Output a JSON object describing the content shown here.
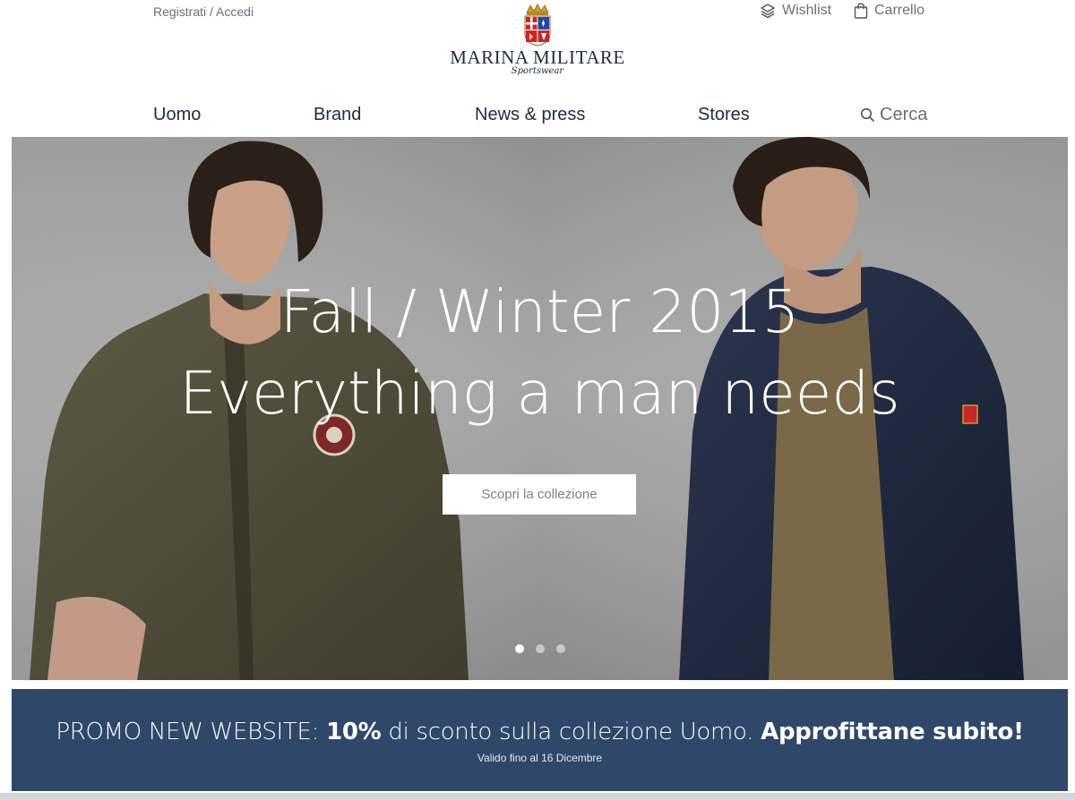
{
  "header": {
    "account_link": "Registrati / Accedi",
    "wishlist_label": "Wishlist",
    "cart_label": "Carrello",
    "logo": {
      "name": "MARINA MILITARE",
      "tagline": "Sportswear"
    }
  },
  "nav": {
    "items": [
      {
        "label": "Uomo"
      },
      {
        "label": "Brand"
      },
      {
        "label": "News & press"
      },
      {
        "label": "Stores"
      }
    ],
    "search_label": "Cerca"
  },
  "hero": {
    "title_line1": "Fall / Winter 2015",
    "title_line2": "Everything a man needs",
    "cta_label": "Scopri la collezione",
    "slides_total": 3,
    "active_slide": 1
  },
  "promo": {
    "prefix": "PROMO NEW WEBSITE: ",
    "discount": "10%",
    "middle": " di sconto sulla collezione Uomo. ",
    "cta": "Approfittane subito!",
    "validity": "Valido fino al 16 Dicembre"
  },
  "colors": {
    "brand_navy": "#1e2b45",
    "promo_bg": "#2f4769",
    "muted_text": "#6b6f78"
  },
  "icons": [
    "layers-icon",
    "shopping-bag-icon",
    "search-icon",
    "crest-icon"
  ]
}
